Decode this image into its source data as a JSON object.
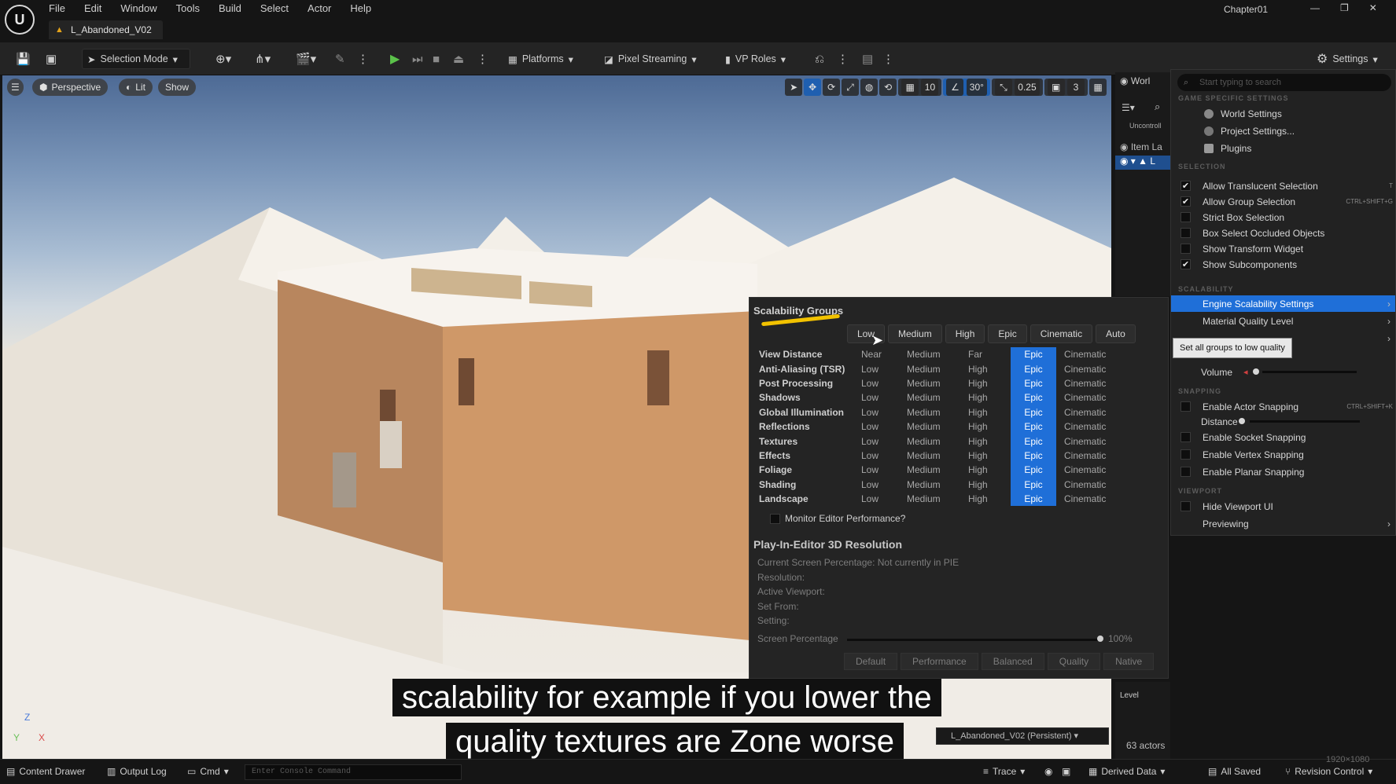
{
  "app": {
    "logo": "U",
    "project_name": "Chapter01",
    "map_tab": "L_Abandoned_V02"
  },
  "menu": [
    "File",
    "Edit",
    "Window",
    "Tools",
    "Build",
    "Select",
    "Actor",
    "Help"
  ],
  "toolbar": {
    "selection_mode": "Selection Mode",
    "platforms": "Platforms",
    "pixel_streaming": "Pixel Streaming",
    "vp_roles": "VP Roles",
    "settings": "Settings"
  },
  "viewport": {
    "perspective": "Perspective",
    "lit": "Lit",
    "show": "Show",
    "grid_size": "10",
    "rotation_snap": "30°",
    "scale_snap": "0.25",
    "camera_speed": "3",
    "axis_z": "Z",
    "axis_x": "X",
    "axis_y": "Y"
  },
  "scalability": {
    "title": "Scalability Groups",
    "presets": [
      "Low",
      "Medium",
      "High",
      "Epic",
      "Cinematic",
      "Auto"
    ],
    "rows": [
      {
        "name": "View Distance",
        "levels": [
          "Near",
          "Medium",
          "Far",
          "Epic",
          "Cinematic"
        ]
      },
      {
        "name": "Anti-Aliasing (TSR)",
        "levels": [
          "Low",
          "Medium",
          "High",
          "Epic",
          "Cinematic"
        ]
      },
      {
        "name": "Post Processing",
        "levels": [
          "Low",
          "Medium",
          "High",
          "Epic",
          "Cinematic"
        ]
      },
      {
        "name": "Shadows",
        "levels": [
          "Low",
          "Medium",
          "High",
          "Epic",
          "Cinematic"
        ]
      },
      {
        "name": "Global Illumination",
        "levels": [
          "Low",
          "Medium",
          "High",
          "Epic",
          "Cinematic"
        ]
      },
      {
        "name": "Reflections",
        "levels": [
          "Low",
          "Medium",
          "High",
          "Epic",
          "Cinematic"
        ]
      },
      {
        "name": "Textures",
        "levels": [
          "Low",
          "Medium",
          "High",
          "Epic",
          "Cinematic"
        ]
      },
      {
        "name": "Effects",
        "levels": [
          "Low",
          "Medium",
          "High",
          "Epic",
          "Cinematic"
        ]
      },
      {
        "name": "Foliage",
        "levels": [
          "Low",
          "Medium",
          "High",
          "Epic",
          "Cinematic"
        ]
      },
      {
        "name": "Shading",
        "levels": [
          "Low",
          "Medium",
          "High",
          "Epic",
          "Cinematic"
        ]
      },
      {
        "name": "Landscape",
        "levels": [
          "Low",
          "Medium",
          "High",
          "Epic",
          "Cinematic"
        ]
      }
    ],
    "selected_level": "Epic",
    "monitor_label": "Monitor Editor Performance?",
    "pie_title": "Play-In-Editor 3D Resolution",
    "pie_info": [
      "Current Screen Percentage: Not currently in PIE",
      "Resolution:",
      "Active Viewport:",
      "Set From:",
      "Setting:"
    ],
    "screen_percentage_label": "Screen Percentage",
    "screen_percentage_value": "100%",
    "screen_percentage_fraction": 1.0,
    "res_buttons": [
      "Default",
      "Performance",
      "Balanced",
      "Quality",
      "Native"
    ]
  },
  "outliner": {
    "tab": "Worl",
    "uncontrolled": "Uncontroll",
    "item_label": "Item La",
    "row_L": "L"
  },
  "details": {
    "level_label": "Level",
    "level_value": "L_Abandoned_V02 (Persistent)",
    "actors": "63 actors"
  },
  "settings_menu": {
    "search_placeholder": "Start typing to search",
    "sections": {
      "game": "GAME SPECIFIC SETTINGS",
      "selection": "SELECTION",
      "scalability": "SCALABILITY",
      "snapping": "SNAPPING",
      "viewport": "VIEWPORT"
    },
    "game_items": [
      "World Settings",
      "Project Settings...",
      "Plugins"
    ],
    "selection_items": [
      {
        "label": "Allow Translucent Selection",
        "checked": true,
        "shortcut": "T"
      },
      {
        "label": "Allow Group Selection",
        "checked": true,
        "shortcut": "CTRL+SHIFT+G"
      },
      {
        "label": "Strict Box Selection",
        "checked": false,
        "shortcut": ""
      },
      {
        "label": "Box Select Occluded Objects",
        "checked": false,
        "shortcut": ""
      },
      {
        "label": "Show Transform Widget",
        "checked": false,
        "shortcut": ""
      },
      {
        "label": "Show Subcomponents",
        "checked": true,
        "shortcut": ""
      }
    ],
    "engine_scalability": "Engine Scalability Settings",
    "material_quality": "Material Quality Level",
    "tooltip": "Set all groups to low quality",
    "volume_label": "Volume",
    "volume_fraction": 0.0,
    "snapping_items": [
      {
        "label": "Enable Actor Snapping",
        "checked": false,
        "shortcut": "CTRL+SHIFT+K"
      },
      {
        "label": "Enable Socket Snapping",
        "checked": false,
        "shortcut": ""
      },
      {
        "label": "Enable Vertex Snapping",
        "checked": false,
        "shortcut": ""
      },
      {
        "label": "Enable Planar Snapping",
        "checked": false,
        "shortcut": ""
      }
    ],
    "distance_label": "Distance",
    "distance_fraction": 0.0,
    "hide_viewport_ui": "Hide Viewport UI",
    "previewing": "Previewing"
  },
  "statusbar": {
    "content_drawer": "Content Drawer",
    "output_log": "Output Log",
    "cmd": "Cmd",
    "console_placeholder": "Enter Console Command",
    "trace": "Trace",
    "derived_data": "Derived Data",
    "all_saved": "All Saved",
    "revision_control": "Revision Control",
    "resolution": "1920×1080"
  },
  "subtitle": {
    "line1": "scalability for example if you lower the",
    "line2": "quality textures are Zone worse"
  }
}
